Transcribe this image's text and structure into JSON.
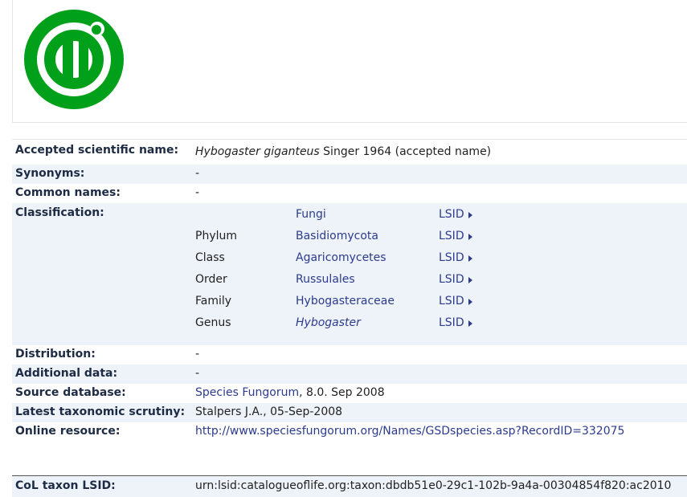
{
  "logo": {
    "icon": "gbif-style-green-logo",
    "color": "#00a01a"
  },
  "record": {
    "accepted_name": {
      "label": "Accepted scientific name:",
      "genus_species": "Hybogaster giganteus",
      "author": " Singer 1964 (accepted name)"
    },
    "synonyms": {
      "label": "Synonyms:",
      "value": "-"
    },
    "common_names": {
      "label": "Common names:",
      "value": "-"
    },
    "classification": {
      "label": "Classification:",
      "rows": [
        {
          "rank": "",
          "taxon": "Fungi",
          "lsid": "LSID"
        },
        {
          "rank": "Phylum",
          "taxon": "Basidiomycota",
          "lsid": "LSID"
        },
        {
          "rank": "Class",
          "taxon": "Agaricomycetes",
          "lsid": "LSID"
        },
        {
          "rank": "Order",
          "taxon": "Russulales",
          "lsid": "LSID"
        },
        {
          "rank": "Family",
          "taxon": "Hybogasteraceae",
          "lsid": "LSID"
        },
        {
          "rank": "Genus",
          "taxon": "Hybogaster",
          "lsid": "LSID"
        }
      ]
    },
    "distribution": {
      "label": "Distribution:",
      "value": "-"
    },
    "additional_data": {
      "label": "Additional data:",
      "value": "-"
    },
    "source_database": {
      "label": "Source database:",
      "link": "Species Fungorum",
      "rest": ", 8.0. Sep 2008"
    },
    "scrutiny": {
      "label": "Latest taxonomic scrutiny:",
      "value": "Stalpers J.A., 05-Sep-2008"
    },
    "online_resource": {
      "label": "Online resource:",
      "url_text": "http://www.speciesfungorum.org/Names/GSDspecies.asp?RecordID=332075"
    },
    "col_lsid": {
      "label": "CoL taxon LSID:",
      "value": "urn:lsid:catalogueoflife.org:taxon:dbdb51e0-29c1-102b-9a4a-00304854f820:ac2010"
    }
  },
  "colors": {
    "link": "#2c3b8c",
    "shade": "#eef3fa",
    "label": "#1d2b44"
  }
}
